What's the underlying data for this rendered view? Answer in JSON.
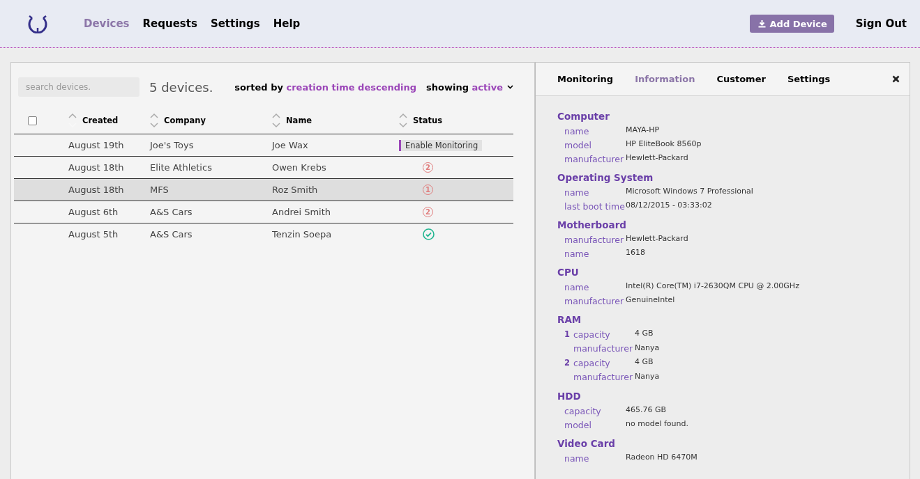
{
  "nav": {
    "items": [
      {
        "label": "Devices",
        "selected": true
      },
      {
        "label": "Requests",
        "selected": false
      },
      {
        "label": "Settings",
        "selected": false
      },
      {
        "label": "Help",
        "selected": false
      }
    ],
    "add_button": "Add Device",
    "sign_out": "Sign Out"
  },
  "devices": {
    "search": {
      "placeholder": "search devices."
    },
    "count": "5 devices.",
    "sort_label": "sorted by",
    "sort_value": "creation time descending",
    "filter_label": "showing",
    "filter_value": "active",
    "select_all": {
      "checked": false
    },
    "columns": [
      {
        "label": "Created",
        "sorted": true
      },
      {
        "label": "Company",
        "sorted": false
      },
      {
        "label": "Name",
        "sorted": false
      },
      {
        "label": "Status",
        "sorted": false
      }
    ],
    "rows": [
      {
        "created": "August 19th",
        "company": "Joe's Toys",
        "name": "Joe Wax",
        "status": {
          "kind": "button",
          "text": "Enable Monitoring"
        },
        "selected": false
      },
      {
        "created": "August 18th",
        "company": "Elite Athletics",
        "name": "Owen Krebs",
        "status": {
          "kind": "alerts",
          "text": "2"
        },
        "selected": false
      },
      {
        "created": "August 18th",
        "company": "MFS",
        "name": "Roz Smith",
        "status": {
          "kind": "alerts",
          "text": "1"
        },
        "selected": true
      },
      {
        "created": "August 6th",
        "company": "A&S Cars",
        "name": "Andrei Smith",
        "status": {
          "kind": "alerts",
          "text": "2"
        },
        "selected": false
      },
      {
        "created": "August 5th",
        "company": "A&S Cars",
        "name": "Tenzin Soepa",
        "status": {
          "kind": "ok"
        },
        "selected": false
      }
    ]
  },
  "detail": {
    "tabs": [
      {
        "label": "Monitoring",
        "selected": false
      },
      {
        "label": "Information",
        "selected": true
      },
      {
        "label": "Customer",
        "selected": false
      },
      {
        "label": "Settings",
        "selected": false
      }
    ],
    "sections": [
      {
        "title": "Computer",
        "kind": "fields",
        "fields": [
          {
            "label": "name",
            "value": "MAYA-HP"
          },
          {
            "label": "model",
            "value": "HP EliteBook 8560p"
          },
          {
            "label": "manufacturer",
            "value": "Hewlett-Packard"
          }
        ]
      },
      {
        "title": "Operating System",
        "kind": "fields",
        "fields": [
          {
            "label": "name",
            "value": "Microsoft Windows 7 Professional"
          },
          {
            "label": "last boot time",
            "value": "08/12/2015 - 03:33:02"
          }
        ]
      },
      {
        "title": "Motherboard",
        "kind": "fields",
        "fields": [
          {
            "label": "manufacturer",
            "value": "Hewlett-Packard"
          },
          {
            "label": "name",
            "value": "1618"
          }
        ]
      },
      {
        "title": "CPU",
        "kind": "fields",
        "fields": [
          {
            "label": "name",
            "value": "Intel(R) Core(TM) i7-2630QM CPU @ 2.00GHz"
          },
          {
            "label": "manufacturer",
            "value": "GenuineIntel"
          }
        ]
      },
      {
        "title": "RAM",
        "kind": "modules",
        "modules": [
          {
            "index": "1",
            "fields": [
              {
                "label": "capacity",
                "value": "4 GB"
              },
              {
                "label": "manufacturer",
                "value": "Nanya"
              }
            ]
          },
          {
            "index": "2",
            "fields": [
              {
                "label": "capacity",
                "value": "4 GB"
              },
              {
                "label": "manufacturer",
                "value": "Nanya"
              }
            ]
          }
        ]
      },
      {
        "title": "HDD",
        "kind": "fields",
        "fields": [
          {
            "label": "capacity",
            "value": "465.76 GB"
          },
          {
            "label": "model",
            "value": "no model found."
          }
        ]
      },
      {
        "title": "Video Card",
        "kind": "fields",
        "fields": [
          {
            "label": "name",
            "value": "Radeon HD 6470M"
          }
        ]
      }
    ]
  }
}
